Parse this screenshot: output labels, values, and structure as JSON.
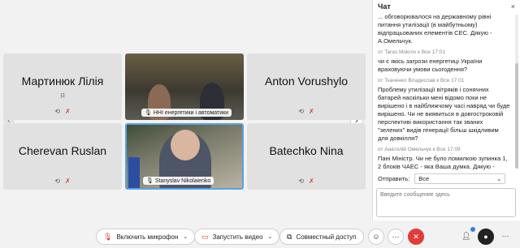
{
  "tiles": [
    {
      "name": "Мартинюк Лілія",
      "sub": "Я"
    },
    {
      "label": "ННІ енергетики і автоматики"
    },
    {
      "name": "Anton Vorushylo"
    },
    {
      "name": "Cherevan Ruslan"
    },
    {
      "label": "Stanyslav Nikolaienko"
    },
    {
      "name": "Batechko Nina"
    }
  ],
  "chat": {
    "title": "Чат",
    "close": "×",
    "messages": [
      {
        "meta": "",
        "body": "... обговорювалося на державному рівні питання утилізації (в майбутньому) відпрацьованих елементів СЕС. Дякую - А.Омельчук."
      },
      {
        "meta": "от Taras Mokrov к Все    17:01",
        "body": "чи є якісь загрози енергетиці України враховуючи умови сьогодення?"
      },
      {
        "meta": "от Ткаченко Владислав к Все    17:01",
        "body": "Проблему утилізації вітряків і сонячних батарей наскільки мені відомо поки не вирішено і в найближчому часі навряд чи буде вирішено. Чи не виявиться в довгостроковій перспективі використання так званих \"зелених\" видів генерації більш шкідливим для довкілля?"
      },
      {
        "meta": "от Анатолій Омельчук к Все    17:09",
        "body": "Пані Міністр. Чи не було помилкою зупинка 1, 2 блоків ЧАЕС - яка Ваша думка. Дякую - А.Омельчук."
      }
    ],
    "send_to_label": "Отправить:",
    "send_to_value": "Все",
    "input_placeholder": "Введите сообщение здесь"
  },
  "toolbar": {
    "mic_label": "Включить микрофон",
    "video_label": "Запустить видео",
    "share_label": "Совместный доступ"
  },
  "colors": {
    "end_call": "#e23b3b",
    "active_speaker": "#5aa0e6",
    "muted": "#d13a3a"
  }
}
